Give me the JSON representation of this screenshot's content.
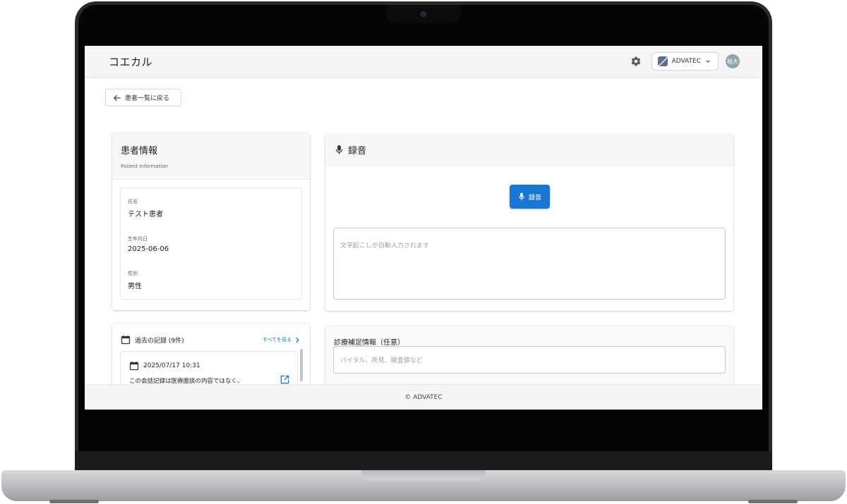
{
  "header": {
    "brand": "コエカル",
    "org_name": "ADVATEC",
    "avatar_initials": "裕大"
  },
  "nav": {
    "back_label": "患者一覧に戻る"
  },
  "patient": {
    "title": "患者情報",
    "subtitle": "Patient Information",
    "fields": [
      {
        "label": "氏名",
        "value": "テスト患者"
      },
      {
        "label": "生年月日",
        "value": "2025-06-06"
      },
      {
        "label": "性別",
        "value": "男性"
      }
    ]
  },
  "records": {
    "title": "過去の記録 (9件)",
    "see_all": "すべてを見る",
    "items": [
      {
        "date": "2025/07/17 10:31",
        "text": "この会話記録は医療面談の内容ではなく、"
      }
    ]
  },
  "recording": {
    "title": "録音",
    "button_label": "録音",
    "transcript_placeholder": "文字起こしが自動入力されます"
  },
  "supplement": {
    "title": "診療補足情報（任意）",
    "placeholder": "バイタル、所見、検査値など"
  },
  "footer": {
    "copyright": "© ADVATEC"
  },
  "colors": {
    "accent": "#1976d2",
    "appbar": "#f5f5f5"
  },
  "icons": [
    "gear-icon",
    "chevron-down-icon",
    "arrow-left-icon",
    "microphone-icon",
    "calendar-icon",
    "chevron-right-icon",
    "open-external-icon"
  ]
}
